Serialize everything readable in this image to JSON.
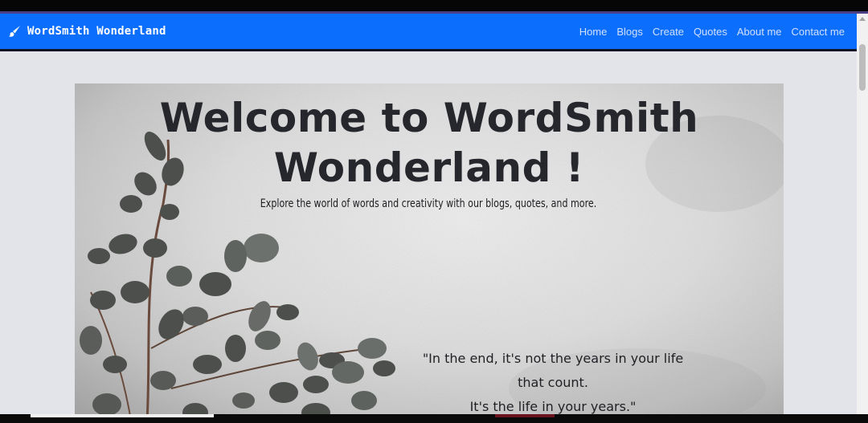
{
  "brand": {
    "name": "WordSmith Wonderland",
    "icon": "paintbrush-icon"
  },
  "nav": {
    "links": [
      {
        "label": "Home"
      },
      {
        "label": "Blogs"
      },
      {
        "label": "Create"
      },
      {
        "label": "Quotes"
      },
      {
        "label": "About me"
      },
      {
        "label": "Contact me"
      }
    ]
  },
  "hero": {
    "title_line1": "Welcome to WordSmith",
    "title_line2": "Wonderland !",
    "subtitle": "Explore the world of words and creativity with our blogs, quotes, and more.",
    "quote_line1": "\"In the end, it's not the years in your life",
    "quote_line2": "that count.",
    "quote_line3": "It's the life in your years.\""
  },
  "colors": {
    "navbar": "#0c6efc",
    "page_background": "#e2e4ea",
    "title_text": "#25272d",
    "nav_link_text": "#cfe0ff"
  }
}
